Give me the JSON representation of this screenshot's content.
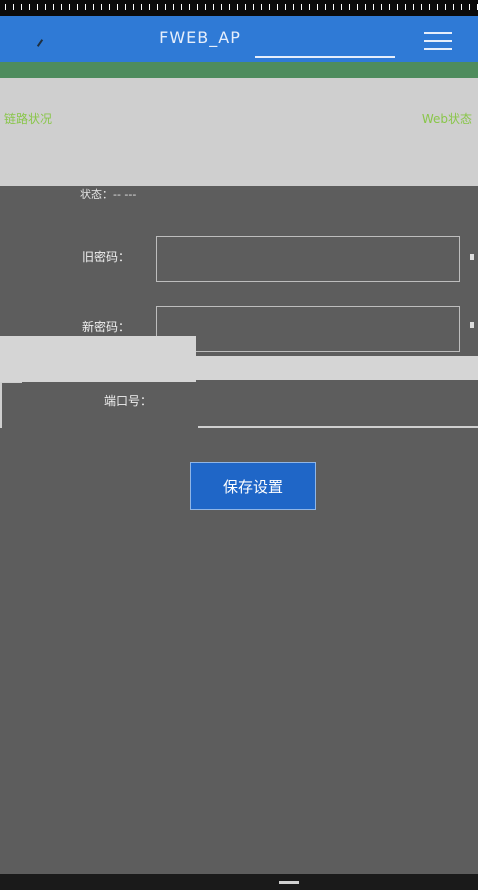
{
  "app": {
    "title": "FWEB_AP",
    "header_left_hint": "",
    "accent": "#2f7ad6",
    "status_green": "#89c64a"
  },
  "info": {
    "left_label": "链路状况",
    "right_label": "Web状态"
  },
  "form": {
    "status_text": "状态：-- ---",
    "fields": [
      {
        "label": "旧密码：",
        "value": "",
        "placeholder": ""
      },
      {
        "label": "新密码：",
        "value": "",
        "placeholder": ""
      }
    ],
    "port_label": "端口号："
  },
  "actions": {
    "save_label": "保存设置"
  },
  "icons": {
    "back": "back-arrow-icon",
    "menu": "menu-icon",
    "home": "home-indicator"
  }
}
